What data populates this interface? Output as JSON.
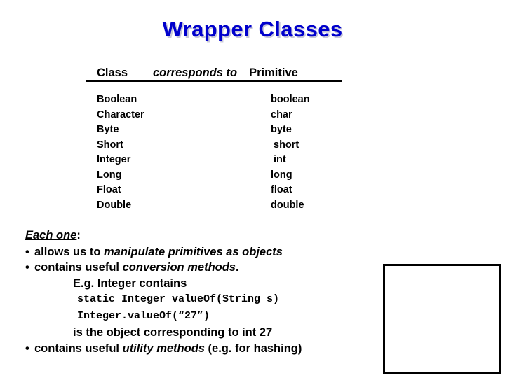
{
  "slide": {
    "title": "Wrapper Classes",
    "title_color": "#0000CC",
    "background_color": "#FFFFFF"
  },
  "table": {
    "headers": {
      "class": "Class",
      "corresponds": "corresponds to",
      "primitive": "Primitive"
    },
    "rows": [
      {
        "wrapper": "Boolean",
        "primitive": "boolean"
      },
      {
        "wrapper": "Character",
        "primitive": "char"
      },
      {
        "wrapper": "Byte",
        "primitive": "byte"
      },
      {
        "wrapper": "Short",
        "primitive": " short"
      },
      {
        "wrapper": "Integer",
        "primitive": " int"
      },
      {
        "wrapper": "Long",
        "primitive": "long"
      },
      {
        "wrapper": "Float",
        "primitive": "float"
      },
      {
        "wrapper": "Double",
        "primitive": "double"
      }
    ]
  },
  "notes": {
    "lead_emphasis": "Each one",
    "lead_colon": ":",
    "bullet_char": "•",
    "bullet1_plain": "allows us to ",
    "bullet1_italic": "manipulate primitives as objects",
    "bullet2_plain": "contains useful ",
    "bullet2_italic": "conversion methods",
    "bullet2_tail": ".",
    "example_intro": "E.g. Integer contains",
    "code_signature": "static Integer valueOf(String s)",
    "code_call": "Integer.valueOf(“27”)",
    "example_explain": "is the object corresponding to int 27",
    "bullet3_plain": "contains useful ",
    "bullet3_italic": "utility methods",
    "bullet3_tail": " (e.g. for hashing)"
  },
  "placeholder": {
    "label": "empty-content-box",
    "border_color": "#000000"
  }
}
